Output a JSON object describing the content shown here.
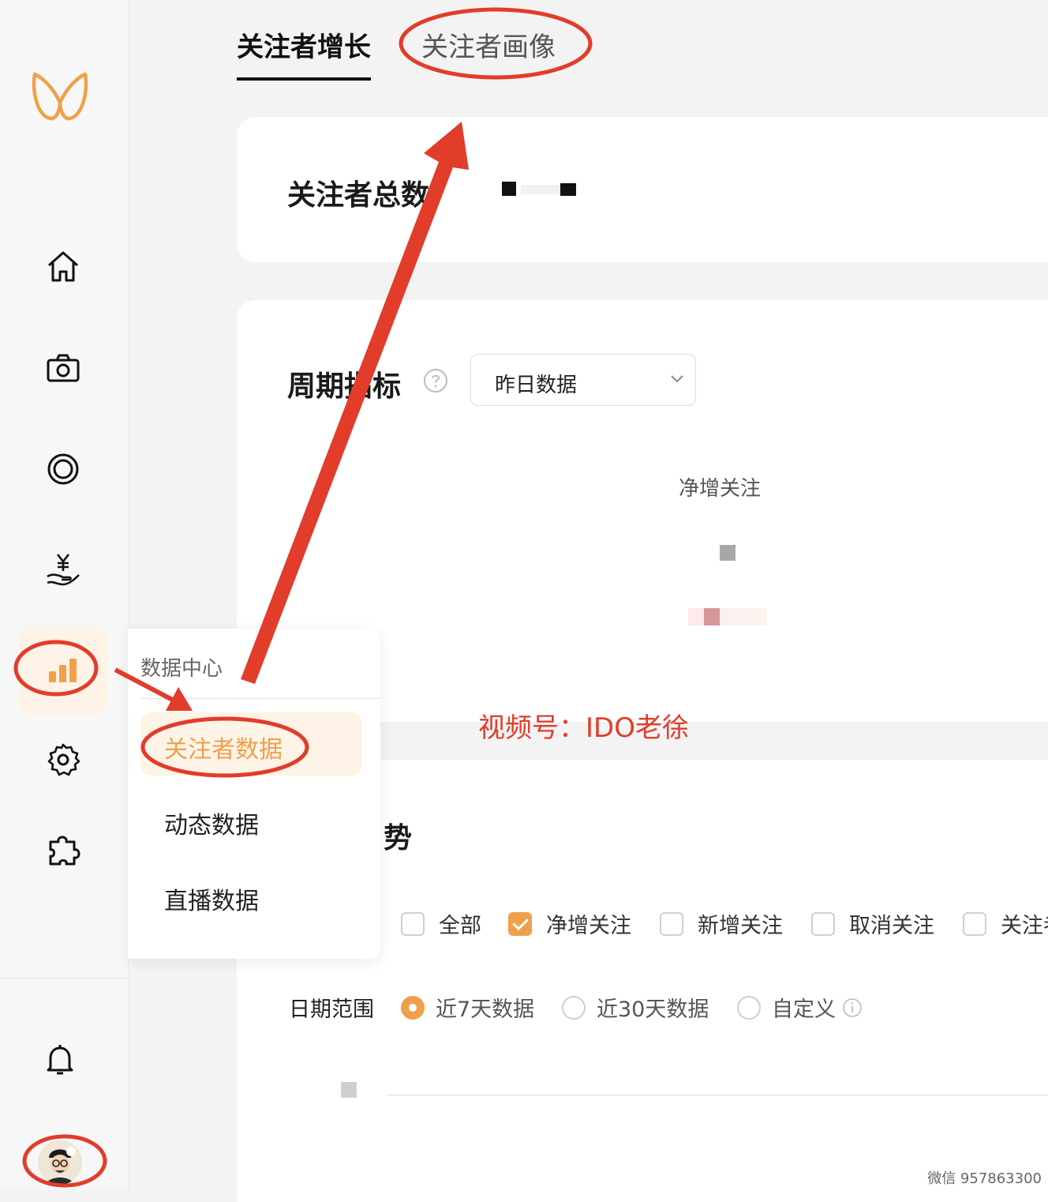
{
  "tabs": [
    {
      "label": "关注者增长"
    },
    {
      "label": "关注者画像"
    }
  ],
  "total": {
    "label": "关注者总数"
  },
  "period": {
    "title": "周期指标",
    "select_value": "昨日数据",
    "metric_label": "净增关注"
  },
  "trend": {
    "title": "势",
    "checkboxes": [
      {
        "label": "全部",
        "checked": false
      },
      {
        "label": "净增关注",
        "checked": true
      },
      {
        "label": "新增关注",
        "checked": false
      },
      {
        "label": "取消关注",
        "checked": false
      },
      {
        "label": "关注者",
        "checked": false
      }
    ],
    "date_label": "日期范围",
    "ranges": [
      {
        "label": "近7天数据",
        "selected": true
      },
      {
        "label": "近30天数据",
        "selected": false
      },
      {
        "label": "自定义",
        "selected": false
      }
    ]
  },
  "dropdown": {
    "header": "数据中心",
    "items": [
      {
        "label": "关注者数据",
        "active": true
      },
      {
        "label": "动态数据",
        "active": false
      },
      {
        "label": "直播数据",
        "active": false
      }
    ]
  },
  "annotation": {
    "text": "视频号：IDO老徐"
  },
  "watermark": "微信 957863300",
  "colors": {
    "accent": "#f0a04b",
    "annotation": "#e23c2a"
  }
}
